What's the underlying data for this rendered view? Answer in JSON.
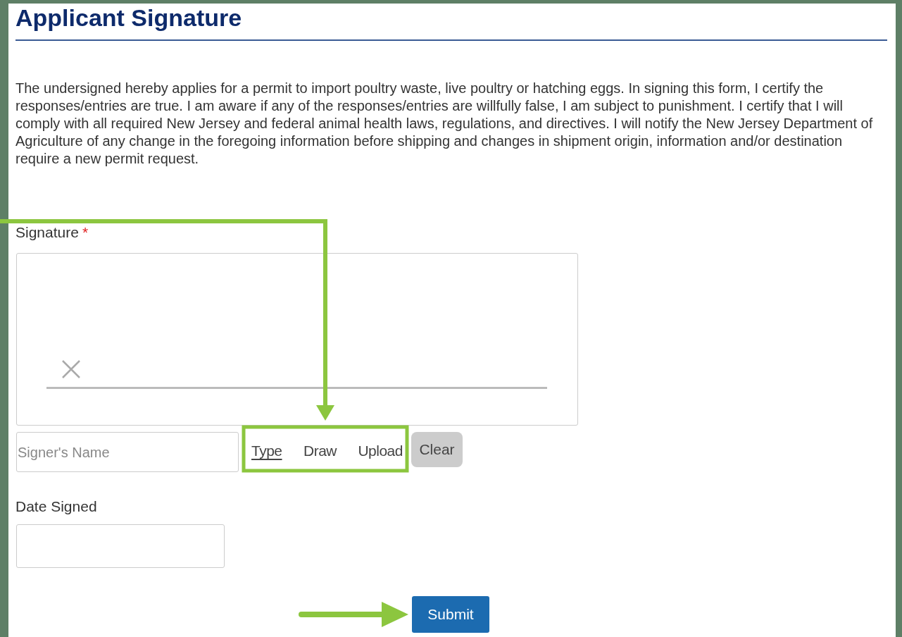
{
  "title": "Applicant Signature",
  "statement": "The undersigned hereby applies for a permit to import poultry waste, live poultry or hatching eggs. In signing this form, I certify the responses/entries are true. I am aware if any of the responses/entries are willfully false, I am subject to punishment. I certify that I will comply with all required New Jersey and federal animal health laws, regulations, and directives. I will notify the New Jersey Department of Agriculture of any change in the foregoing information before shipping and changes in shipment origin, information and/or destination require a new permit request.",
  "signature": {
    "label": "Signature",
    "required_mark": "*",
    "signer_name": {
      "placeholder": "Signer's Name"
    },
    "modes": [
      {
        "label": "Type",
        "selected": true
      },
      {
        "label": "Draw",
        "selected": false
      },
      {
        "label": "Upload",
        "selected": false
      }
    ],
    "clear_button": "Clear"
  },
  "date_signed": {
    "label": "Date Signed"
  },
  "submit_button": "Submit"
}
